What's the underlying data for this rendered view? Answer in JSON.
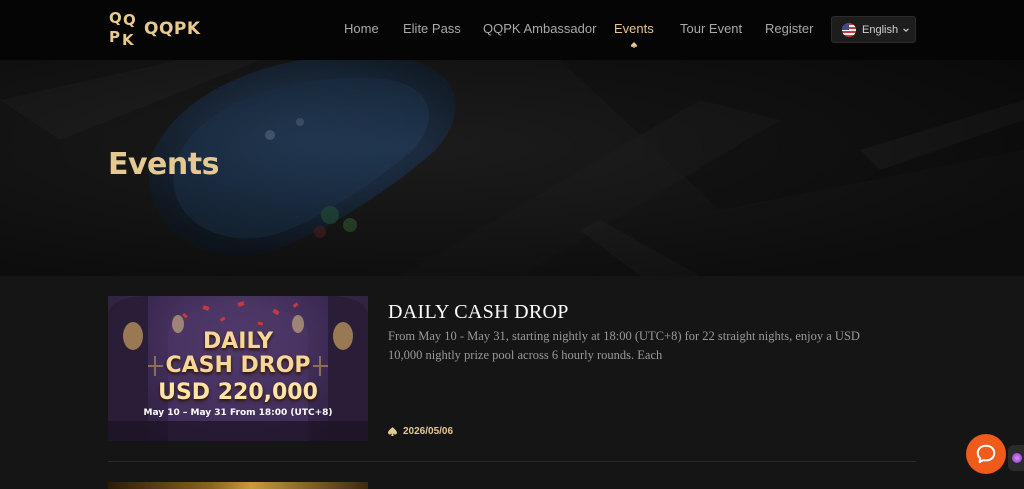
{
  "nav": {
    "logo": {
      "mark_letters": [
        "Q",
        "Q",
        "P",
        "K"
      ],
      "text": "QQPK"
    },
    "items": [
      {
        "label": "Home",
        "active": false
      },
      {
        "label": "Elite Pass",
        "active": false
      },
      {
        "label": "QQPK Ambassador",
        "active": false
      },
      {
        "label": "Events",
        "active": true
      },
      {
        "label": "Tour Event",
        "active": false
      },
      {
        "label": "Register",
        "active": false
      }
    ],
    "language": {
      "label": "English",
      "icon": "us-flag-icon"
    }
  },
  "hero": {
    "title": "Events"
  },
  "events": [
    {
      "title": "DAILY CASH DROP",
      "description": "From May 10 - May 31, starting nightly at 18:00 (UTC+8) for 22 straight nights, enjoy a USD 10,000 nightly prize pool across 6 hourly rounds. Each",
      "date": "2026/05/06",
      "image_text": {
        "line1": "DAILY",
        "line2": "CASH DROP",
        "line3": "USD 220,000",
        "line4": "May 10 – May 31 From 18:00 (UTC+8)"
      }
    }
  ],
  "icons": {
    "active_indicator": "spade-icon",
    "date": "spade-icon",
    "chat": "chat-bubble-icon",
    "language_dropdown": "chevron-down-icon"
  },
  "colors": {
    "accent_gold": "#e4c992",
    "nav_background": "#050505",
    "page_background": "#151515",
    "chat_button": "#f05a1a"
  }
}
